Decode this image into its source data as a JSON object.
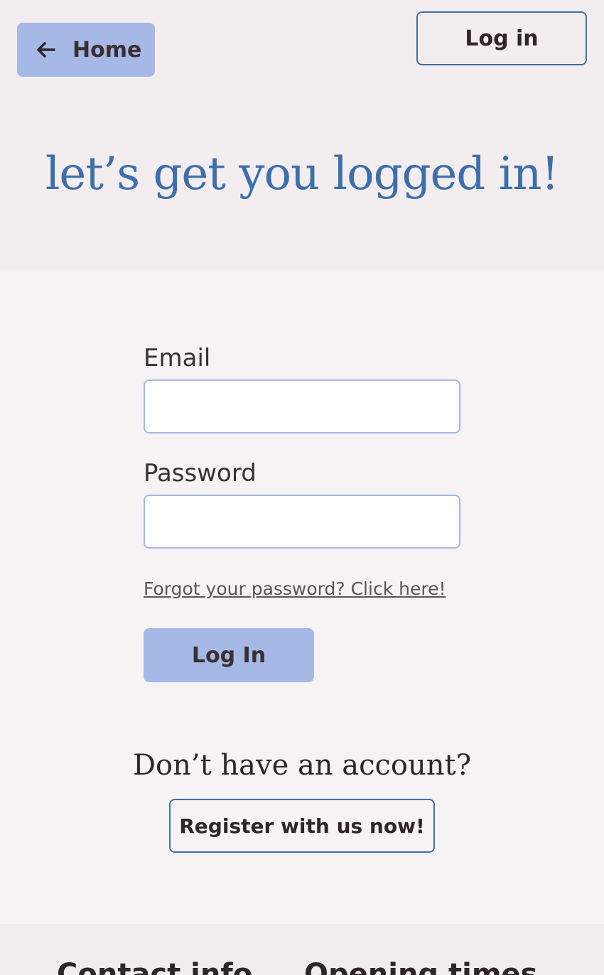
{
  "nav": {
    "home_label": "Home",
    "login_label": "Log in"
  },
  "header": {
    "title": "let’s get you logged in!"
  },
  "form": {
    "email_label": "Email",
    "email_value": "",
    "password_label": "Password",
    "password_value": "",
    "forgot_link": "Forgot your password? Click here!",
    "submit_label": "Log In"
  },
  "register": {
    "prompt": "Don’t have an account?",
    "button_label": "Register with us now!"
  },
  "footer": {
    "contact_heading": "Contact info",
    "hours_heading": "Opening times"
  },
  "colors": {
    "accent": "#a6b8e6",
    "title": "#3d6fab",
    "border": "#3f6fa6"
  },
  "icons": {
    "home": "arrow-left-icon"
  }
}
